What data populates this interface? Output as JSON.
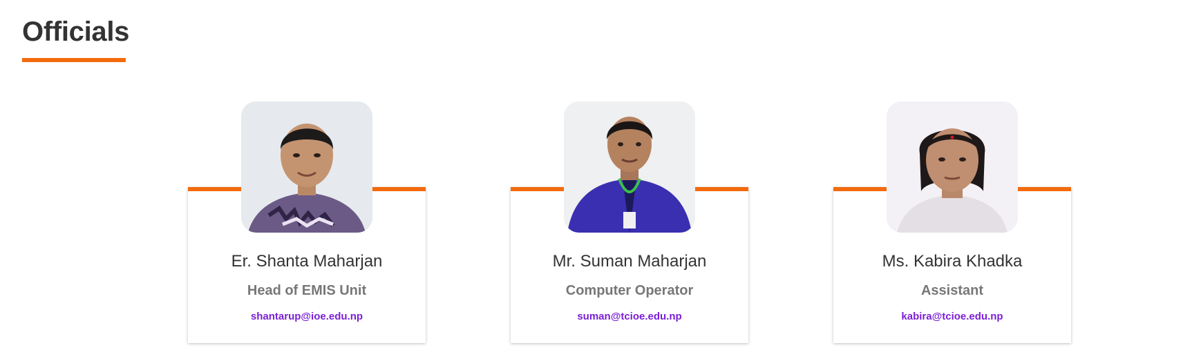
{
  "section": {
    "title": "Officials"
  },
  "colors": {
    "accent": "#f36b0d",
    "email_link": "#7b1fd6",
    "name_text": "#333333",
    "role_text": "#777777"
  },
  "officials": [
    {
      "name": "Er. Shanta Maharjan",
      "role": "Head of EMIS Unit",
      "email": "shantarup@ioe.edu.np",
      "photo_icon": "person-photo"
    },
    {
      "name": "Mr. Suman Maharjan",
      "role": "Computer Operator",
      "email": "suman@tcioe.edu.np",
      "photo_icon": "person-photo"
    },
    {
      "name": "Ms. Kabira Khadka",
      "role": "Assistant",
      "email": "kabira@tcioe.edu.np",
      "photo_icon": "person-photo"
    }
  ]
}
